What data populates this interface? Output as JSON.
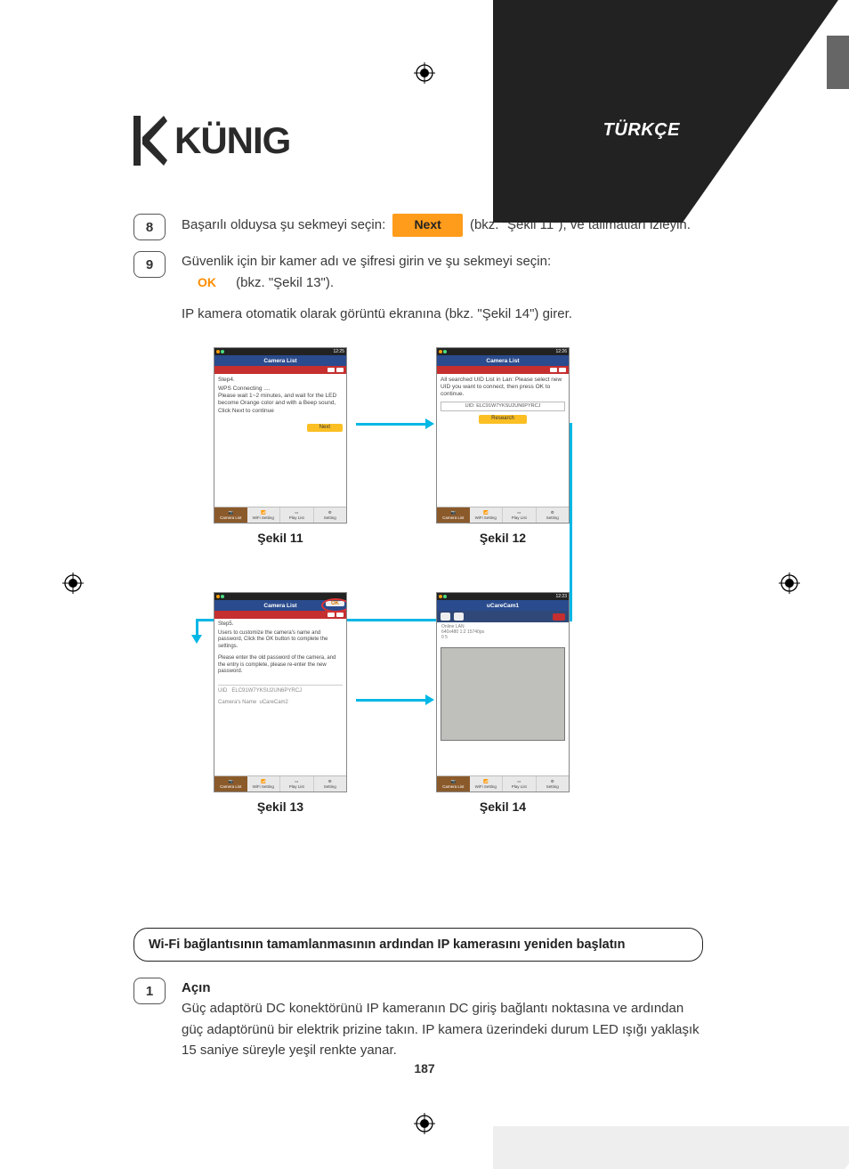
{
  "language_label": "TÜRKÇE",
  "logo_text": "KÜNIG",
  "page_number": "187",
  "steps": {
    "s8": {
      "num": "8",
      "before_btn": "Başarılı olduysa şu sekmeyi seçin:",
      "btn_label": "Next",
      "after_btn": "(bkz. \"Şekil 11\"), ve talimatları izleyin."
    },
    "s9": {
      "num": "9",
      "line1": "Güvenlik için bir kamer adı ve şifresi girin ve şu sekmeyi seçin:",
      "btn_label": "OK",
      "after_btn": "(bkz. \"Şekil 13\").",
      "line3": "IP kamera otomatik olarak görüntü ekranına (bkz. \"Şekil 14\") girer."
    }
  },
  "figures": {
    "f11": {
      "caption": "Şekil 11",
      "header": "Camera List",
      "status_time": "12:25",
      "body_title": "Step4.",
      "body_text": "WPS Connecting ....\nPlease wait 1~2 minutes, and wait for the LED become Orange color and with a Beep sound, Click Next to continue",
      "button": "Next"
    },
    "f12": {
      "caption": "Şekil 12",
      "header": "Camera List",
      "status_time": "12:26",
      "body_text": "All searched UID List in Lan: Please select new UID you want to connect, then press OK to continue.",
      "uid_label": "UID",
      "uid_value": "ELC91W7YKSU2UN6PYRCJ",
      "button": "Research"
    },
    "f13": {
      "caption": "Şekil 13",
      "header": "Camera List",
      "header_ok": "OK",
      "body_title": "Step5.",
      "body_text1": "Users to customize the camera's name and password, Click the OK button to complete the settings.",
      "body_text2": "Please enter the old password of the camera, and the entry is complete, please re-enter the new password.",
      "uid_label": "UID",
      "uid_value": "ELC91W7YKSU2UN6PYRCJ",
      "name_label": "Camera's Name",
      "name_value": "uCareCam2"
    },
    "f14": {
      "caption": "Şekil 14",
      "header": "uCareCam1",
      "status_time": "12:23",
      "info_line1": "Online   LAN",
      "info_line2": "640x480   1:2   15740ps",
      "sub": "0   5"
    },
    "bottombar": {
      "i1": "Camera List",
      "i2": "WiFi Setting",
      "i3": "Play List",
      "i4": "Setting"
    }
  },
  "notice": "Wi-Fi bağlantısının tamamlanmasının ardından IP kamerasını yeniden başlatın",
  "final": {
    "num": "1",
    "title": "Açın",
    "text": "Güç adaptörü DC konektörünü IP kameranın DC giriş bağlantı noktasına ve ardından güç adaptörünü bir elektrik prizine takın. IP kamera üzerindeki durum LED ışığı yaklaşık 15 saniye süreyle yeşil renkte yanar."
  }
}
